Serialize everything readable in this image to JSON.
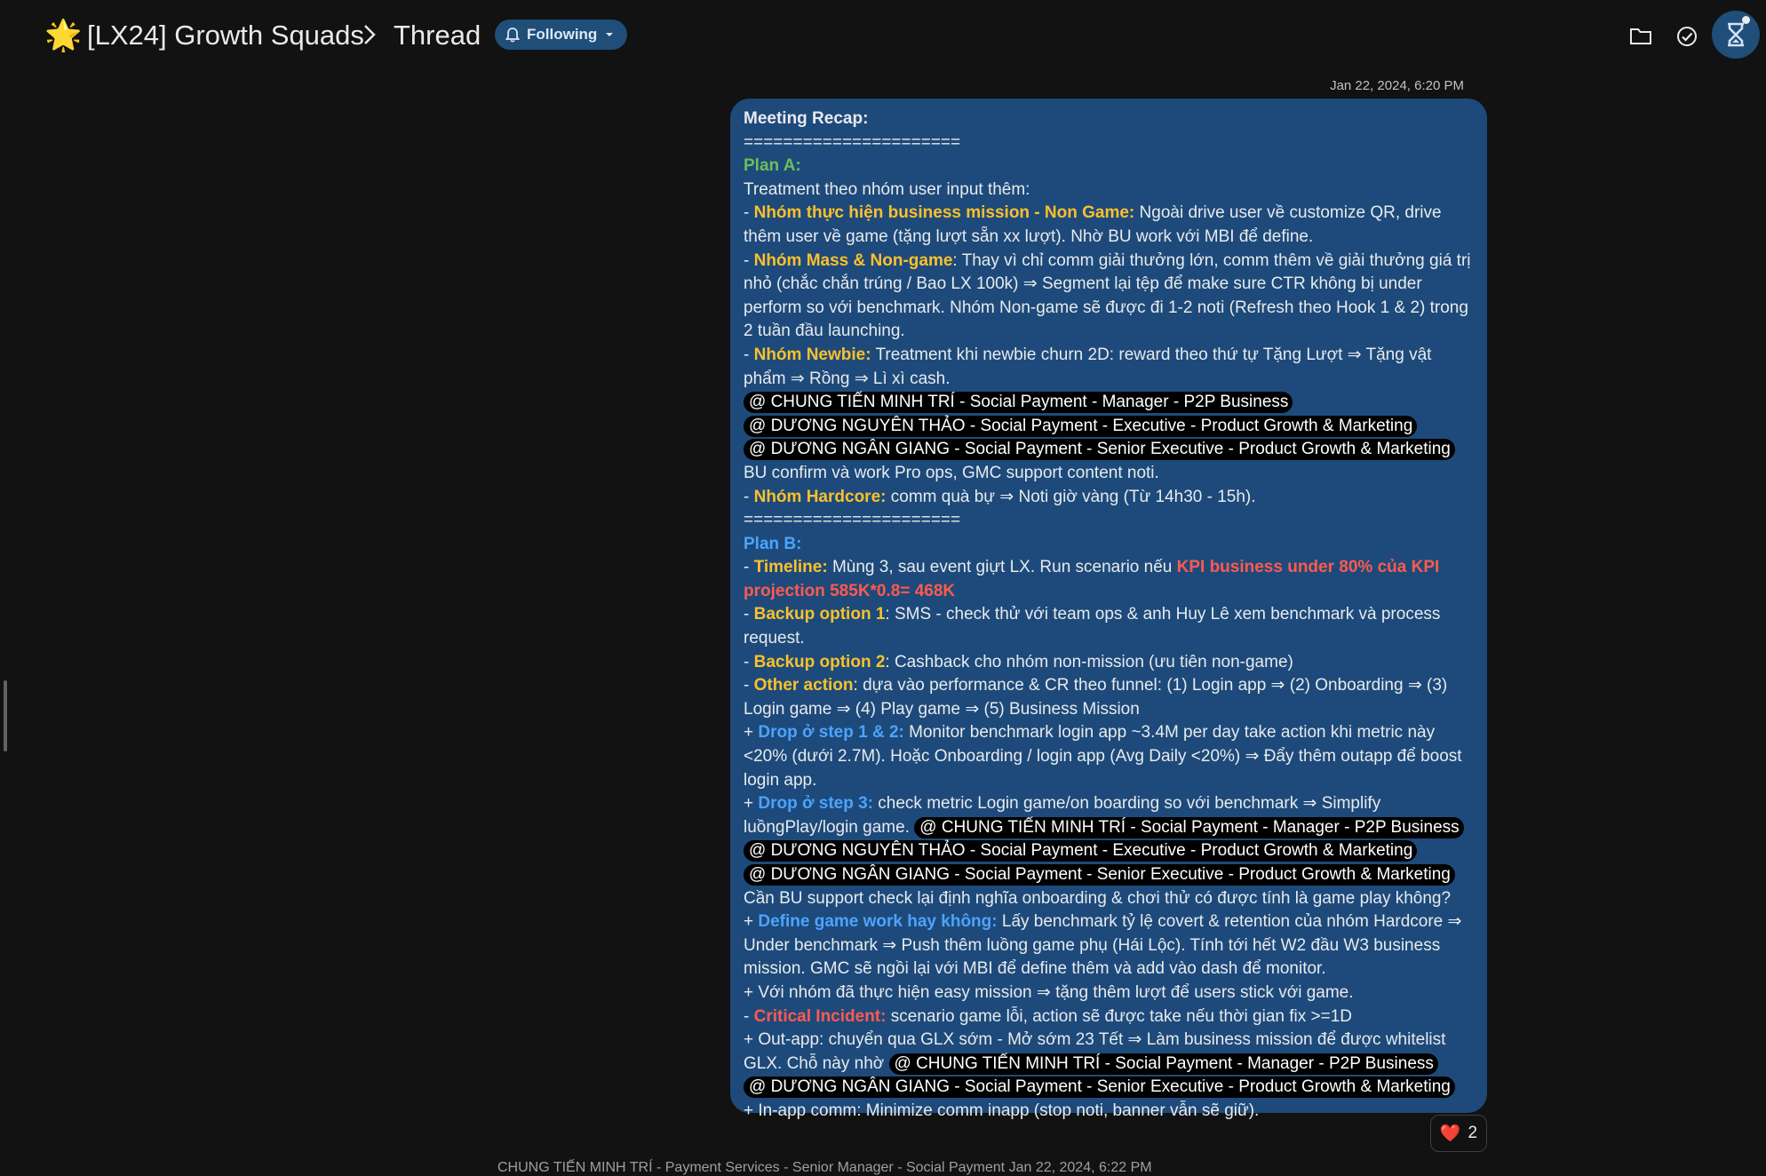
{
  "header": {
    "space_title": "[LX24] Growth Squads",
    "thread_title": "Thread",
    "following_label": "Following"
  },
  "icons": {
    "space": "star-emoji",
    "breadcrumb_separator": "chevron-right-icon",
    "following": "bell-icon",
    "following_menu": "caret-down-icon",
    "files": "folder-icon",
    "tasks": "check-circle-icon",
    "profile": "hourglass-avatar-icon"
  },
  "colors": {
    "bubble": "#1d4a7a",
    "yellow": "#fbc02d",
    "green": "#6bbf59",
    "blue": "#4da3ff",
    "red": "#ff5a4f"
  },
  "message": {
    "timestamp": "Jan 22, 2024, 6:20 PM",
    "title": "Meeting Recap:",
    "divider": "======================",
    "plan_a": "Plan A:",
    "plan_a_intro": "Treatment theo nhóm user input thêm:",
    "dash": "- ",
    "plus": "+ ",
    "g1_label": "Nhóm thực hiện business mission - Non Game:",
    "g1_text": " Ngoài drive user về customize QR, drive thêm user về game (tặng lượt sẵn xx lượt). Nhờ BU work với MBI để define.",
    "g2_label": "Nhóm Mass & Non-game",
    "g2_text": ": Thay vì chỉ comm giải thưởng lớn, comm thêm về giải thưởng giá trị nhỏ (chắc chắn trúng / Bao LX 100k) ⇒ Segment lại tệp để make sure CTR không bị under perform so với benchmark. Nhóm Non-game sẽ được đi 1-2 noti (Refresh theo Hook 1 & 2) trong 2 tuần đầu launching.",
    "g3_label": "Nhóm Newbie:",
    "g3_text": " Treatment khi newbie churn 2D: reward theo thứ tự Tặng Lượt ⇒ Tặng vật phẩm ⇒ Rồng ⇒ Lì xì cash. ",
    "g3_after": " BU confirm và work Pro ops, GMC support content noti.",
    "g4_label": "Nhóm Hardcore:",
    "g4_text": " comm quà bự ⇒ Noti giờ vàng (Từ 14h30 - 15h).",
    "plan_b": "Plan B:",
    "b1_label": "Timeline:",
    "b1_text": " Mùng 3, sau event giựt LX. Run scenario nếu ",
    "b1_red": "KPI business under 80% của KPI projection 585K*0.8= 468K",
    "b2_label": "Backup option 1",
    "b2_text": ": SMS - check thử với team ops & anh Huy Lê xem benchmark và process request.",
    "b3_label": "Backup option 2",
    "b3_text": ": Cashback cho nhóm non-mission (ưu tiên non-game)",
    "b4_label": "Other action",
    "b4_text": ": dựa vào performance & CR theo funnel: (1) Login app ⇒ (2) Onboarding ⇒ (3) Login game ⇒ (4) Play game ⇒ (5) Business Mission",
    "s1_label": "Drop ở step 1 & 2:",
    "s1_text": " Monitor benchmark login app ~3.4M per day take action khi metric này <20% (dưới 2.7M). Hoặc Onboarding / login app (Avg Daily <20%) ⇒ Đẩy thêm outapp để boost login app.",
    "s2_label": "Drop ở step 3:",
    "s2_text": " check metric Login game/on boarding so với benchmark ⇒ Simplify luồngPlay/login game. ",
    "s2_after": " Cần BU support check lại định nghĩa onboarding & chơi thử có được tính là game play không?",
    "s3_label": "Define game work hay không:",
    "s3_text": " Lấy benchmark tỷ lệ covert & retention của nhóm Hardcore ⇒ Under benchmark ⇒ Push thêm luồng game phụ (Hái Lộc). Tính tới hết W2 đầu W3 business mission. GMC sẽ ngồi lại với MBI để define thêm và add vào dash để monitor.",
    "s4_text": "+ Với nhóm đã thực hiện easy mission ⇒ tặng thêm lượt để users stick với game.",
    "ci_label": "Critical Incident:",
    "ci_text": " scenario game lỗi, action sẽ được take nếu thời gian fix >=1D",
    "ci1_text": "+ Out-app: chuyển qua GLX sớm - Mở sớm 23 Tết ⇒ Làm business mission để được whitelist GLX. Chỗ này nhờ ",
    "ci2_text": "+ In-app comm: Minimize comm inapp (stop noti, banner vẫn sẽ giữ).",
    "mention_tri": "@ CHUNG TIẾN MINH TRÍ - Social Payment - Manager - P2P Business",
    "mention_thao": "@ DƯƠNG NGUYÊN THẢO - Social Payment - Executive - Product Growth & Marketing",
    "mention_giang": "@ DƯƠNG NGÂN GIANG - Social Payment - Senior Executive - Product Growth & Marketing"
  },
  "reaction": {
    "emoji": "❤️",
    "count": "2"
  },
  "next_message": {
    "author": "CHUNG TIẾN MINH TRÍ - Payment Services - Senior Manager - Social Payment   Jan 22, 2024, 6:22 PM"
  }
}
